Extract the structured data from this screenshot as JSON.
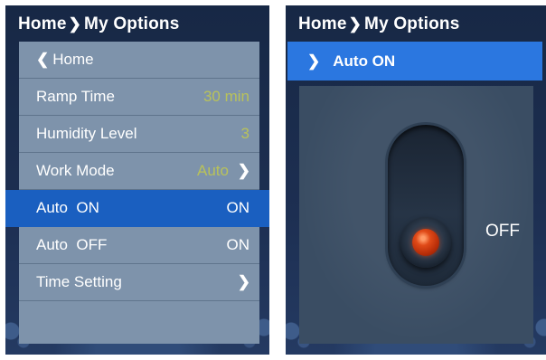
{
  "left_screen": {
    "breadcrumb": {
      "home": "Home",
      "separator": "❯",
      "current": "My Options"
    },
    "menu": {
      "back_chevron": "❮",
      "back_label": "Home",
      "items": [
        {
          "label": "Ramp Time",
          "value": "30 min"
        },
        {
          "label": "Humidity Level",
          "value": "3"
        },
        {
          "label": "Work Mode",
          "value": "Auto",
          "chevron": "❯"
        },
        {
          "label": "Auto  ON",
          "value": "ON"
        },
        {
          "label": "Auto  OFF",
          "value": "ON"
        },
        {
          "label": "Time Setting",
          "chevron": "❯"
        }
      ]
    },
    "colors": {
      "highlight": "#1a5fc0",
      "menu_bg": "#7e93ab",
      "value_text": "#b9c25a"
    }
  },
  "right_screen": {
    "breadcrumb": {
      "home": "Home",
      "separator": "❯",
      "current": "My Options"
    },
    "sub_header": {
      "chevron": "❯",
      "label": "Auto ON"
    },
    "switch": {
      "state": "OFF",
      "icon": "toggle-switch-icon",
      "led_color": "#e04a18"
    },
    "colors": {
      "header": "#2b77e0"
    }
  }
}
